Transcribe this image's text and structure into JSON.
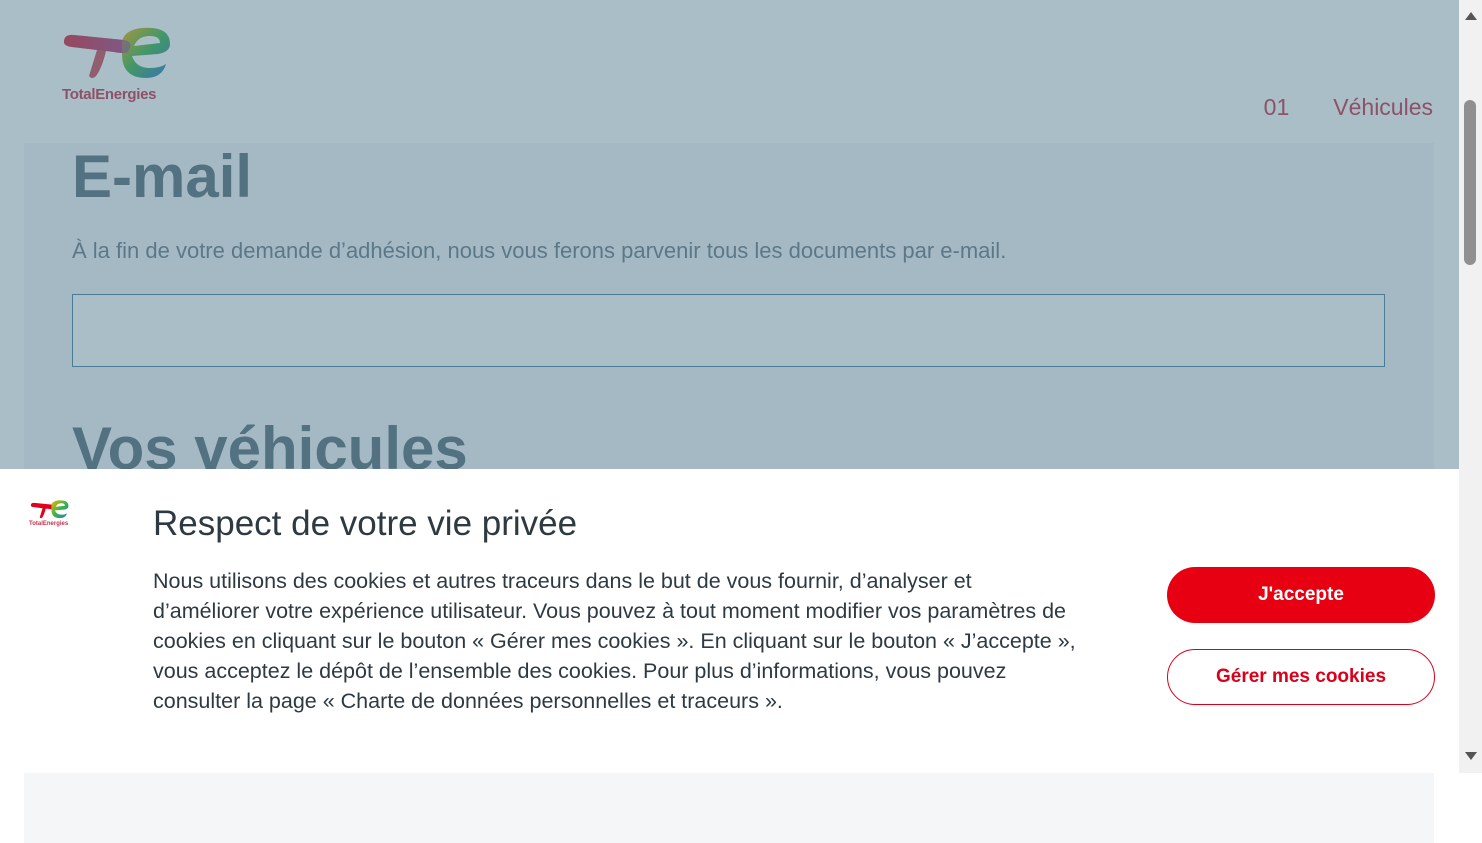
{
  "header": {
    "logo_text": "TotalEnergies",
    "nav": [
      {
        "label": "01"
      },
      {
        "label": "Véhicules"
      }
    ]
  },
  "form": {
    "email_title": "E-mail",
    "email_description": "À la fin de votre demande d’adhésion, nous vous ferons parvenir tous les documents par e-mail.",
    "email_value": "",
    "vehicles_title": "Vos véhicules"
  },
  "cookie_banner": {
    "logo_text": "TotalEnergies",
    "title": "Respect de votre vie privée",
    "text": "Nous utilisons des cookies et autres traceurs dans le but de vous fournir, d’analyser et d’améliorer votre expérience utilisateur. Vous pouvez à tout moment modifier vos paramètres de cookies en cliquant sur le bouton « Gérer mes cookies ». En cliquant sur le bouton « J’accepte », vous acceptez le dépôt de l’ensemble des cookies. Pour plus d’informations, vous pouvez consulter la page « Charte de données personnelles et traceurs ».",
    "accept_label": "J'accepte",
    "manage_label": "Gérer mes cookies"
  },
  "colors": {
    "brand_red": "#e60012",
    "nav_text": "#c8324b",
    "overlay": "#4a748a"
  }
}
